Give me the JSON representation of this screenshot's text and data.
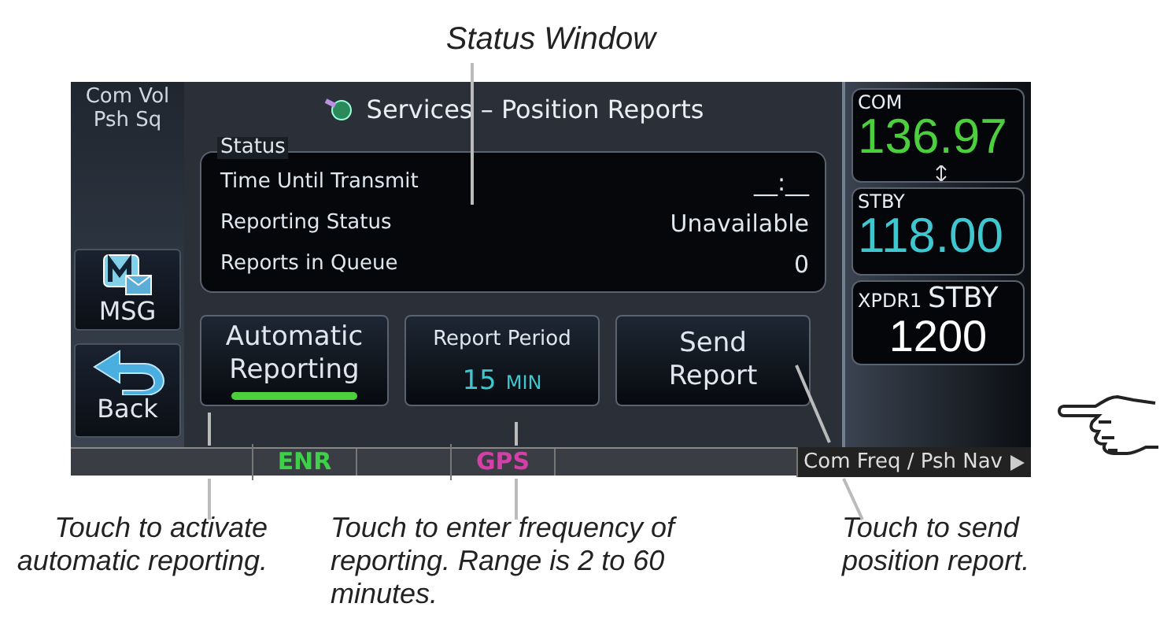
{
  "callout_title": "Status Window",
  "screen": {
    "knob_label": "Com Vol Psh Sq",
    "side_buttons": [
      {
        "kind": "msg",
        "label": "MSG"
      },
      {
        "kind": "back",
        "label": "Back"
      }
    ],
    "title": "Services – Position Reports",
    "status": {
      "legend": "Status",
      "rows": [
        {
          "label": "Time Until Transmit",
          "value": "__:__"
        },
        {
          "label": "Reporting Status",
          "value": "Unavailable"
        },
        {
          "label": "Reports in Queue",
          "value": "0"
        }
      ]
    },
    "buttons": [
      {
        "kind": "toggle",
        "label": "Automatic Reporting",
        "on": true
      },
      {
        "kind": "value",
        "title": "Report Period",
        "value": "15",
        "unit": "MIN"
      },
      {
        "kind": "action",
        "label": "Send Report"
      }
    ],
    "com": {
      "label": "COM",
      "freq": "136.97"
    },
    "stby": {
      "label": "STBY",
      "freq": "118.00"
    },
    "xpdr": {
      "label": "XPDR1",
      "mode": "STBY",
      "code": "1200"
    },
    "status_bar": {
      "segments": [
        {
          "text": "ENR",
          "color": "#3fcf4a"
        },
        {
          "text": "GPS",
          "color": "#d43fa8"
        }
      ],
      "softkey": "Com Freq / Psh Nav"
    }
  },
  "captions": [
    "Touch to activate automatic reporting.",
    "Touch to enter frequency of reporting. Range is 2 to 60 minutes.",
    "Touch to send position report."
  ]
}
